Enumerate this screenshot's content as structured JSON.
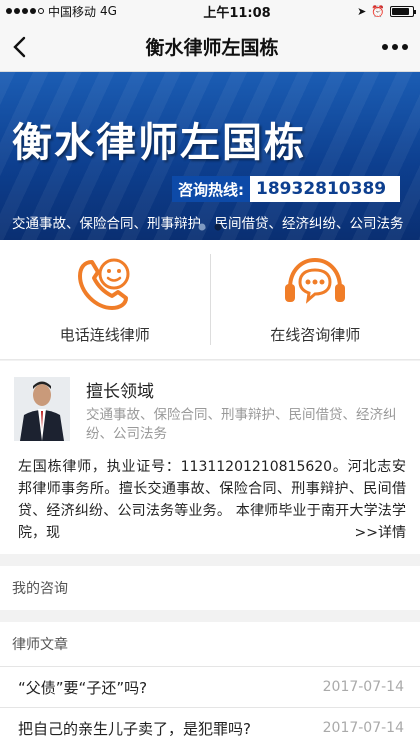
{
  "status_bar": {
    "carrier": "中国移动",
    "network": "4G",
    "time": "上午11:08"
  },
  "nav": {
    "title": "衡水律师左国栋"
  },
  "banner": {
    "title": "衡水律师左国栋",
    "hotline_label": "咨询热线:",
    "hotline_number": "18932810389",
    "services": "交通事故、保险合同、刑事辩护、民间借贷、经济纠纷、公司法务",
    "slide_count": 2,
    "active_slide": 2
  },
  "actions": [
    {
      "label": "电话连线律师",
      "icon": "phone-smile-icon"
    },
    {
      "label": "在线咨询律师",
      "icon": "headset-chat-icon"
    }
  ],
  "colors": {
    "accent": "#f07d28",
    "banner_blue": "#0d3f8f"
  },
  "profile": {
    "expertise_title": "擅长领域",
    "expertise_text": "交通事故、保险合同、刑事辩护、民间借贷、经济纠纷、公司法务",
    "bio": "左国栋律师，执业证号：11311201210815620。河北志安邦律师事务所。擅长交通事故、保险合同、刑事辩护、民间借贷、经济纠纷、公司法务等业务。 本律师毕业于南开大学法学院，现",
    "detail_link": ">>详情"
  },
  "sections": {
    "my_consult": "我的咨询",
    "articles_title": "律师文章"
  },
  "articles": [
    {
      "title": "“父债”要“子还”吗?",
      "date": "2017-07-14"
    },
    {
      "title": "把自己的亲生儿子卖了，是犯罪吗?",
      "date": "2017-07-14"
    }
  ]
}
